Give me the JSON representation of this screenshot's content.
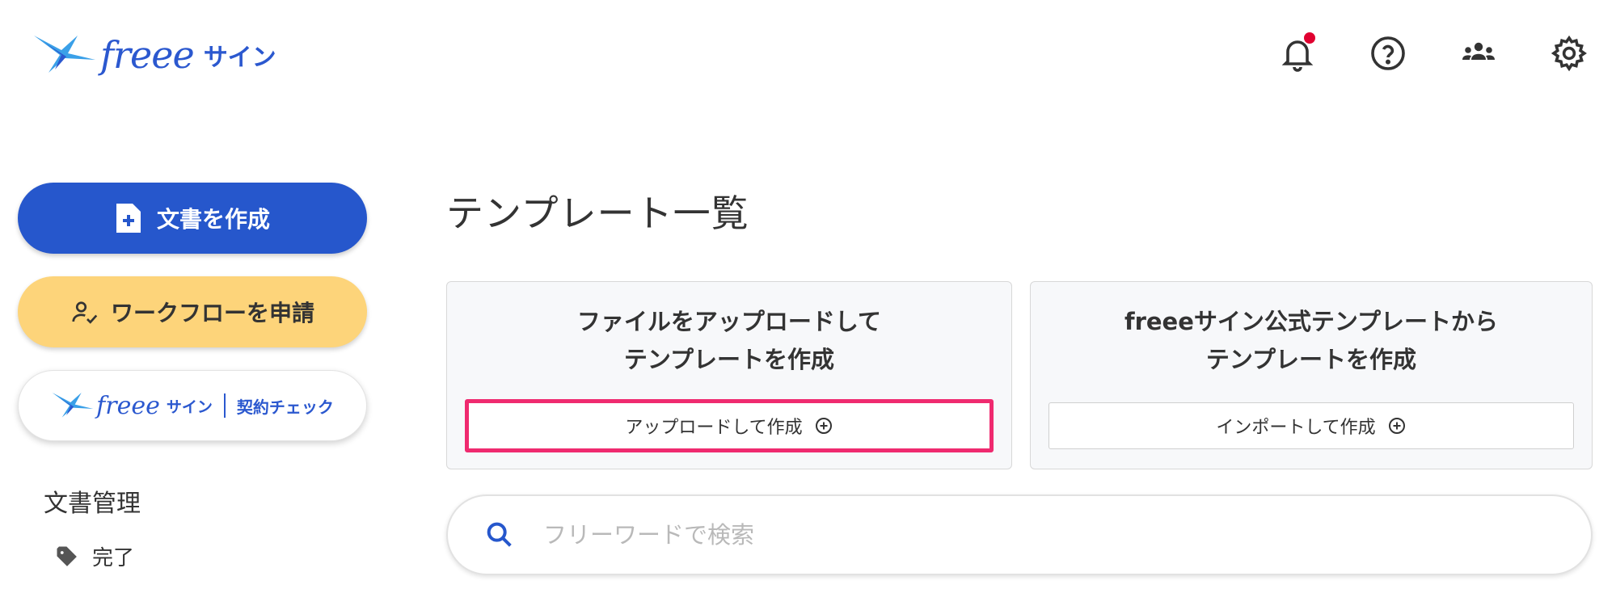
{
  "header": {
    "logo_text": "freee",
    "logo_sub": "サイン",
    "icons": [
      "bell-icon",
      "help-icon",
      "users-icon",
      "gear-icon"
    ],
    "notification_dot_color": "#e00030"
  },
  "sidebar": {
    "create_doc_label": "文書を作成",
    "workflow_label": "ワークフローを申請",
    "contract_freee": "freee",
    "contract_sign": "サイン",
    "contract_check": "契約チェック",
    "section_title": "文書管理",
    "items": [
      {
        "label": "完了",
        "icon": "tag-icon"
      }
    ]
  },
  "main": {
    "page_title": "テンプレート一覧",
    "cards": [
      {
        "title": "ファイルをアップロードして\nテンプレートを作成",
        "button_label": "アップロードして作成"
      },
      {
        "title": "freeeサイン公式テンプレートから\nテンプレートを作成",
        "button_label": "インポートして作成"
      }
    ],
    "search": {
      "placeholder": "フリーワードで検索"
    }
  },
  "colors": {
    "primary": "#2657cc",
    "workflow": "#fdd47a",
    "highlight": "#ef2a6f",
    "brand": "#2b58cf"
  }
}
